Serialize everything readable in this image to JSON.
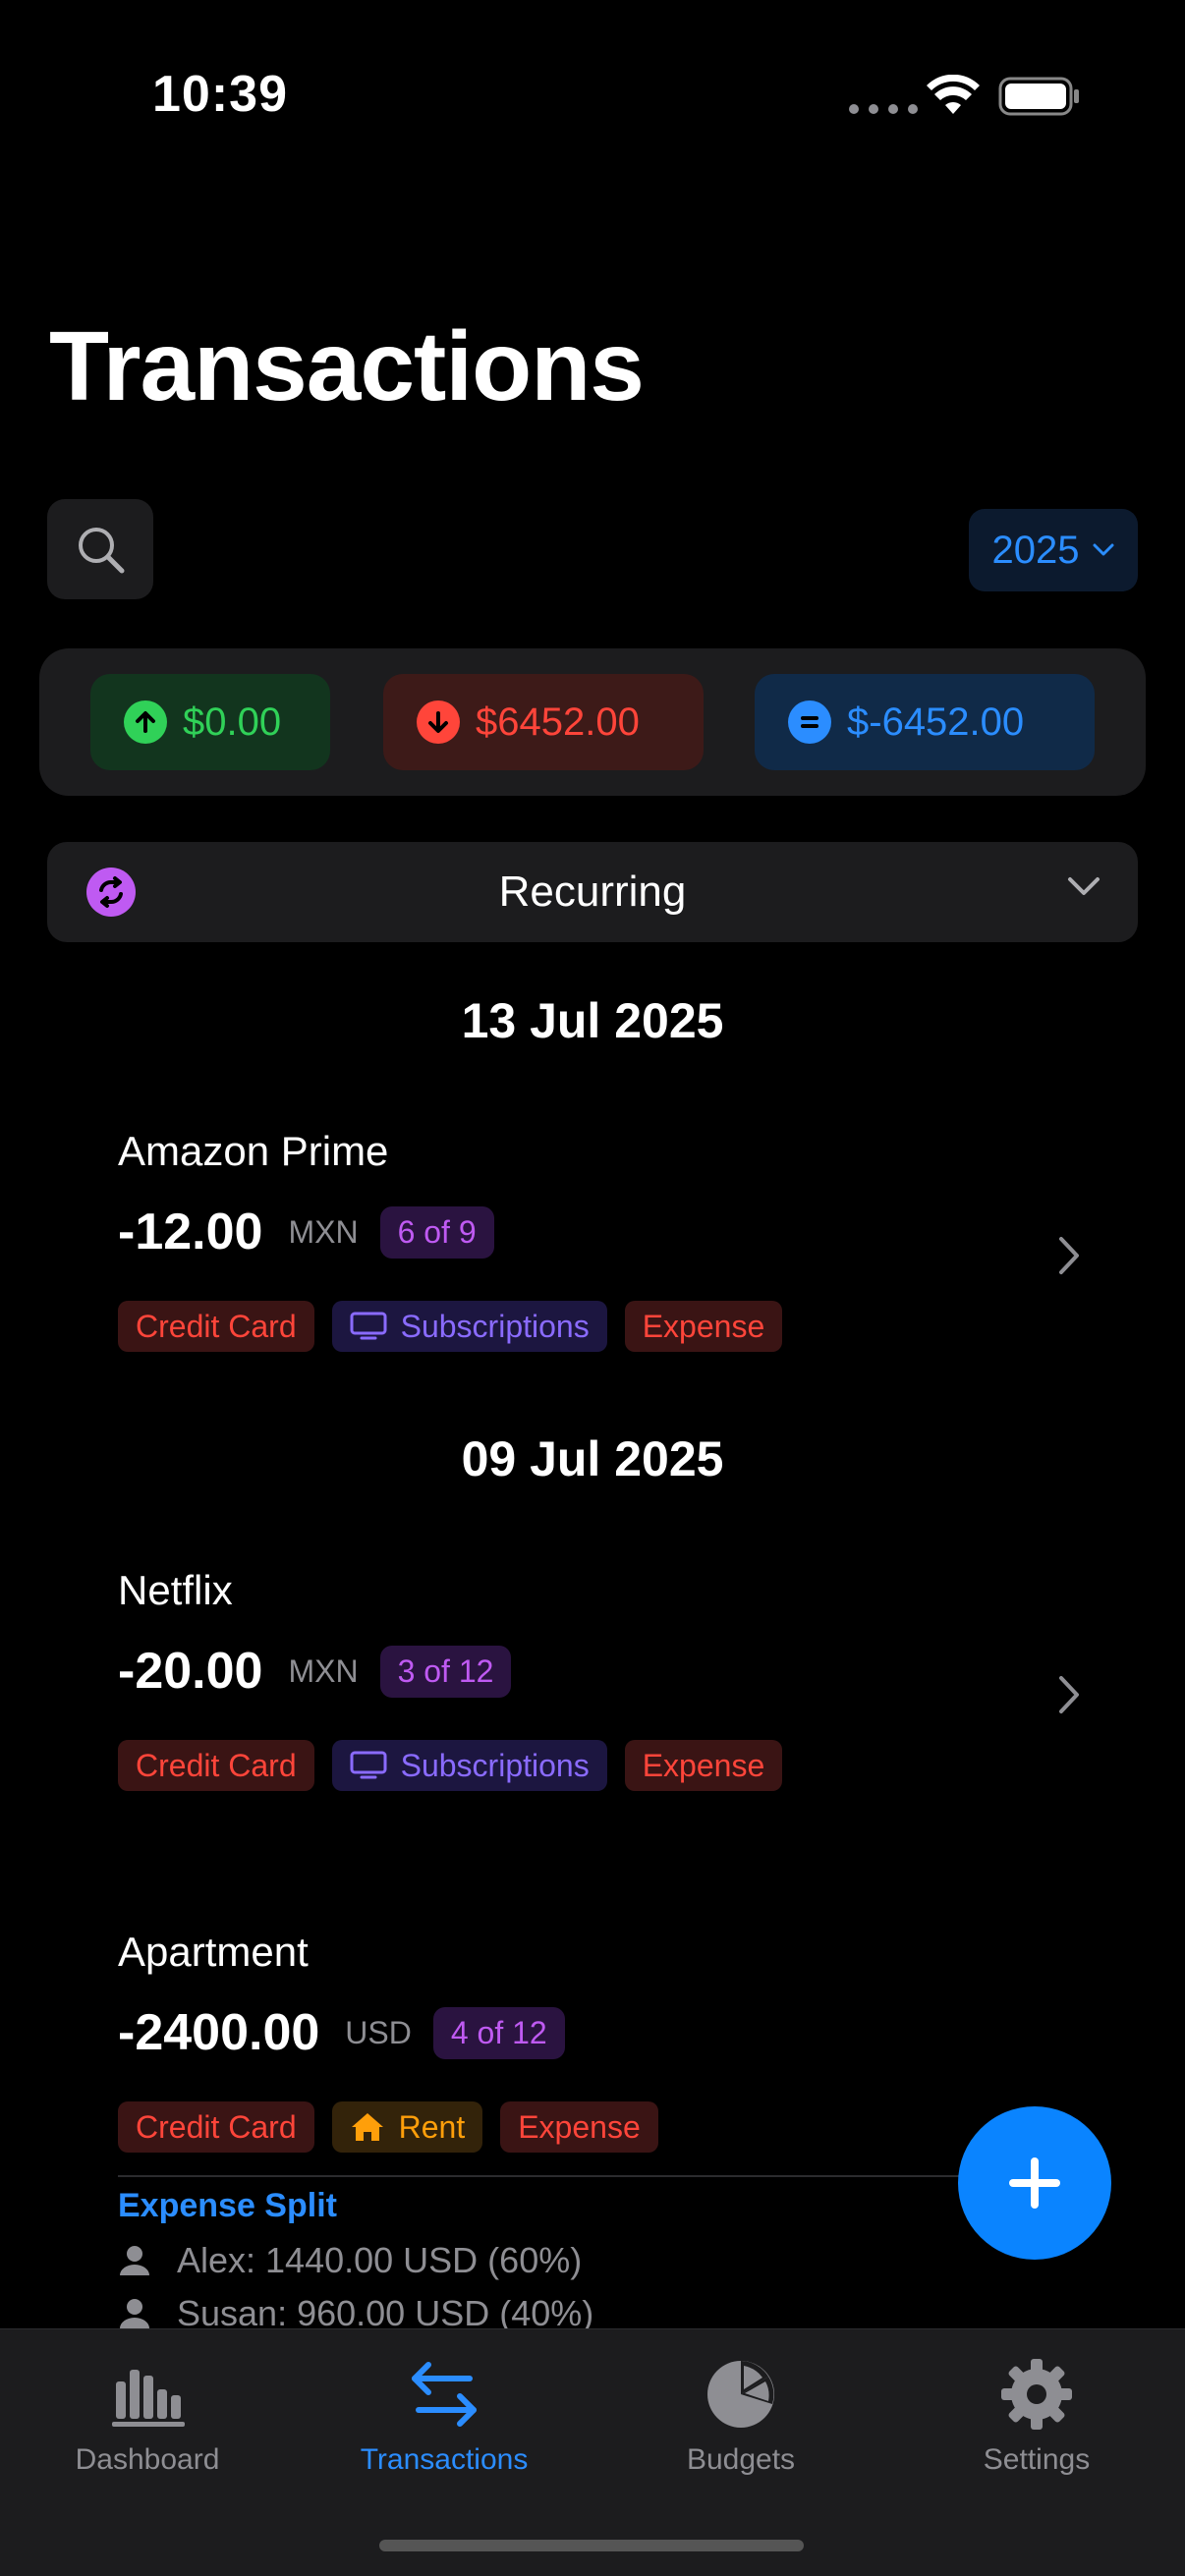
{
  "status_bar": {
    "time": "10:39"
  },
  "header": {
    "title": "Transactions",
    "year": "2025"
  },
  "summary": {
    "income": "$0.00",
    "expense": "$6452.00",
    "balance": "$-6452.00"
  },
  "filter": {
    "label": "Recurring"
  },
  "groups": [
    {
      "date": "13 Jul 2025",
      "transactions": [
        {
          "name": "Amazon Prime",
          "amount": "-12.00",
          "currency": "MXN",
          "count": "6 of 9",
          "tags": [
            "Credit Card",
            "Subscriptions",
            "Expense"
          ]
        }
      ]
    },
    {
      "date": "09 Jul 2025",
      "transactions": [
        {
          "name": "Netflix",
          "amount": "-20.00",
          "currency": "MXN",
          "count": "3 of 12",
          "tags": [
            "Credit Card",
            "Subscriptions",
            "Expense"
          ]
        },
        {
          "name": "Apartment",
          "amount": "-2400.00",
          "currency": "USD",
          "count": "4 of 12",
          "tags": [
            "Credit Card",
            "Rent",
            "Expense"
          ],
          "split": {
            "title": "Expense Split",
            "rows": [
              "Alex: 1440.00 USD (60%)",
              "Susan: 960.00 USD (40%)"
            ]
          }
        }
      ]
    }
  ],
  "tabs": [
    {
      "label": "Dashboard",
      "icon": "chart-bars-icon"
    },
    {
      "label": "Transactions",
      "icon": "arrows-swap-icon",
      "active": true
    },
    {
      "label": "Budgets",
      "icon": "pie-chart-icon"
    },
    {
      "label": "Settings",
      "icon": "gear-icon"
    }
  ],
  "colors": {
    "accent": "#2b8dff",
    "income": "#30d158",
    "expense": "#ff453a",
    "recurring": "#bf5af2"
  }
}
